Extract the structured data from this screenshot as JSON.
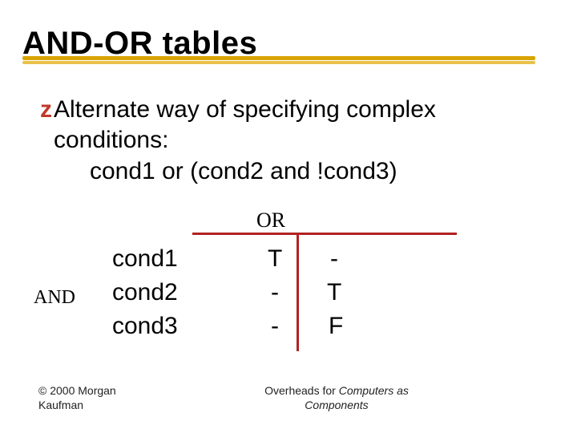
{
  "title": "AND-OR tables",
  "bullet": {
    "symbol": "z",
    "text": "Alternate way of specifying complex conditions:"
  },
  "expression": "cond1 or (cond2 and !cond3)",
  "labels": {
    "or": "OR",
    "and": "AND"
  },
  "table": {
    "rows": [
      {
        "name": "cond1",
        "c1": "T",
        "c2": "-"
      },
      {
        "name": "cond2",
        "c1": "-",
        "c2": "T"
      },
      {
        "name": "cond3",
        "c1": "-",
        "c2": "F"
      }
    ]
  },
  "footer": {
    "left_line1": "© 2000 Morgan",
    "left_line2": "Kaufman",
    "right_prefix": "Overheads for ",
    "right_italic": "Computers as Components"
  },
  "chart_data": {
    "type": "table",
    "title": "AND-OR tables",
    "expression": "cond1 or (cond2 and !cond3)",
    "row_grouping": "AND",
    "column_grouping": "OR",
    "columns": [
      "cond1",
      "cond2",
      "cond3"
    ],
    "or_columns": [
      {
        "cond1": "T",
        "cond2": "-",
        "cond3": "-"
      },
      {
        "cond1": "-",
        "cond2": "T",
        "cond3": "F"
      }
    ]
  }
}
